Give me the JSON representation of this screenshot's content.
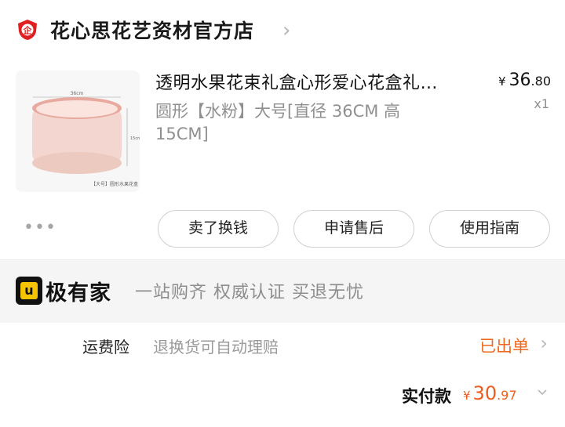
{
  "store": {
    "name": "花心思花艺资材官方店"
  },
  "product": {
    "title": "透明水果花束礼盒心形爱心花盒礼…",
    "spec": "圆形【水粉】大号[直径 36CM 高 15CM]",
    "price_currency": "¥",
    "price_integer": "36",
    "price_decimal": ".80",
    "quantity": "x1",
    "image_caption": "【大号】圆形水果花盒"
  },
  "actions": {
    "more": "•••",
    "sell_label": "卖了换钱",
    "after_sale_label": "申请售后",
    "guide_label": "使用指南"
  },
  "jiyoujia": {
    "name": "极有家",
    "slogan": "一站购齐  权威认证  买退无忧"
  },
  "insurance": {
    "label": "运费险",
    "description": "退换货可自动理赔",
    "status": "已出单"
  },
  "total": {
    "label": "实付款",
    "currency": "¥",
    "integer": "30",
    "decimal": ".97"
  },
  "colors": {
    "accent_orange": "#ee5d1d",
    "store_badge_red": "#e02020",
    "jiyoujia_yellow": "#f6c400"
  },
  "icons": {
    "store_badge": "store-badge-icon",
    "jiyoujia_logo": "jiyoujia-logo-icon"
  }
}
